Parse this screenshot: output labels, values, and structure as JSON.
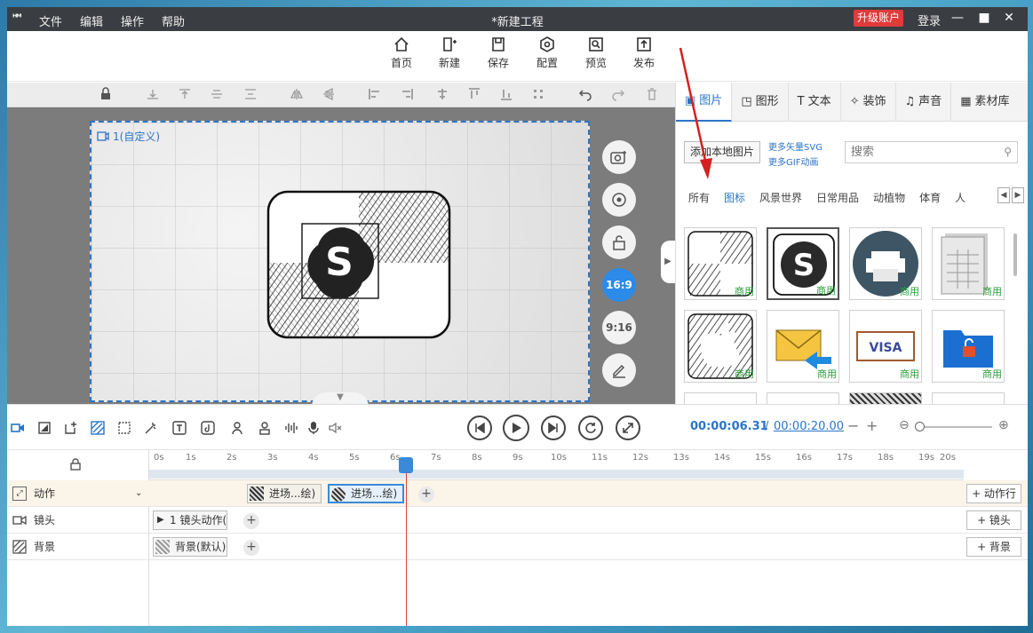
{
  "titlebar": {
    "logo": "ᴴᴹ",
    "menu": [
      "文件",
      "编辑",
      "操作",
      "帮助"
    ],
    "title": "*新建工程",
    "upgrade": "升级账户",
    "login": "登录"
  },
  "toolbar": {
    "home": "首页",
    "new": "新建",
    "save": "保存",
    "config": "配置",
    "preview": "预览",
    "publish": "发布"
  },
  "canvas": {
    "scene_label": "1(自定义)",
    "ratio_169": "16:9",
    "ratio_916": "9:16"
  },
  "panel": {
    "tabs": [
      "图片",
      "图形",
      "文本",
      "装饰",
      "声音",
      "素材库"
    ],
    "tab_icons": [
      "image-icon",
      "shape-icon",
      "text-icon",
      "decoration-icon",
      "sound-icon",
      "library-icon"
    ],
    "add_local": "添加本地图片",
    "more_svg": "更多矢量SVG",
    "more_gif": "更多GIF动画",
    "search_placeholder": "搜索",
    "categories": [
      "所有",
      "图标",
      "风景世界",
      "日常用品",
      "动植物",
      "体育",
      "人"
    ],
    "active_category": "图标",
    "commercial_tag": "商用",
    "items": [
      "checker-sketch",
      "skype-sketch",
      "printer-icon",
      "spreadsheet-icon",
      "apple-sketch",
      "mail-icon",
      "visa-card",
      "folder-lock"
    ]
  },
  "timeline": {
    "current_time": "00:00:06.31",
    "separator": "/",
    "total_time": "00:00:20.00",
    "ruler": [
      "0s",
      "1s",
      "2s",
      "3s",
      "4s",
      "5s",
      "6s",
      "7s",
      "8s",
      "9s",
      "10s",
      "11s",
      "12s",
      "13s",
      "14s",
      "15s",
      "16s",
      "17s",
      "18s",
      "19s",
      "20s"
    ],
    "rows": {
      "action": {
        "label": "动作",
        "clips": [
          "进场...绘)",
          "进场...绘)"
        ],
        "add": "+ 动作行"
      },
      "camera": {
        "label": "镜头",
        "clip": "1 镜头动作(",
        "add": "+ 镜头"
      },
      "background": {
        "label": "背景",
        "clip": "背景(默认)",
        "add": "+ 背景"
      }
    }
  },
  "colors": {
    "accent": "#2c74c6",
    "upgrade": "#e03a3a",
    "commercial": "#2a9d3a",
    "titlebar": "#3a3d42"
  }
}
